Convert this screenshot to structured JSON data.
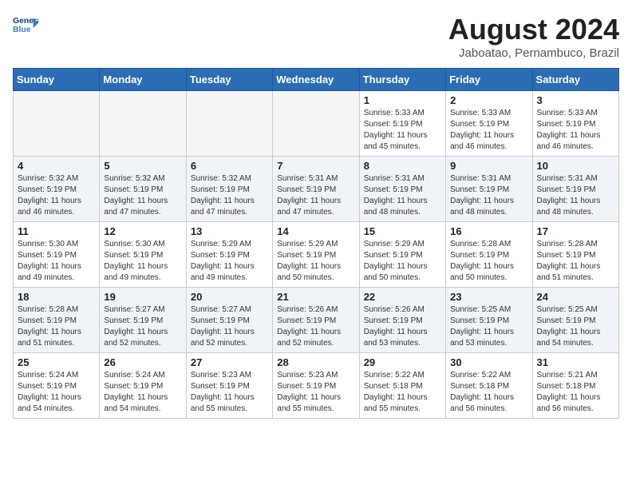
{
  "logo": {
    "line1": "General",
    "line2": "Blue"
  },
  "title": "August 2024",
  "subtitle": "Jaboatao, Pernambuco, Brazil",
  "weekdays": [
    "Sunday",
    "Monday",
    "Tuesday",
    "Wednesday",
    "Thursday",
    "Friday",
    "Saturday"
  ],
  "weeks": [
    [
      {
        "day": "",
        "info": ""
      },
      {
        "day": "",
        "info": ""
      },
      {
        "day": "",
        "info": ""
      },
      {
        "day": "",
        "info": ""
      },
      {
        "day": "1",
        "info": "Sunrise: 5:33 AM\nSunset: 5:19 PM\nDaylight: 11 hours\nand 45 minutes."
      },
      {
        "day": "2",
        "info": "Sunrise: 5:33 AM\nSunset: 5:19 PM\nDaylight: 11 hours\nand 46 minutes."
      },
      {
        "day": "3",
        "info": "Sunrise: 5:33 AM\nSunset: 5:19 PM\nDaylight: 11 hours\nand 46 minutes."
      }
    ],
    [
      {
        "day": "4",
        "info": "Sunrise: 5:32 AM\nSunset: 5:19 PM\nDaylight: 11 hours\nand 46 minutes."
      },
      {
        "day": "5",
        "info": "Sunrise: 5:32 AM\nSunset: 5:19 PM\nDaylight: 11 hours\nand 47 minutes."
      },
      {
        "day": "6",
        "info": "Sunrise: 5:32 AM\nSunset: 5:19 PM\nDaylight: 11 hours\nand 47 minutes."
      },
      {
        "day": "7",
        "info": "Sunrise: 5:31 AM\nSunset: 5:19 PM\nDaylight: 11 hours\nand 47 minutes."
      },
      {
        "day": "8",
        "info": "Sunrise: 5:31 AM\nSunset: 5:19 PM\nDaylight: 11 hours\nand 48 minutes."
      },
      {
        "day": "9",
        "info": "Sunrise: 5:31 AM\nSunset: 5:19 PM\nDaylight: 11 hours\nand 48 minutes."
      },
      {
        "day": "10",
        "info": "Sunrise: 5:31 AM\nSunset: 5:19 PM\nDaylight: 11 hours\nand 48 minutes."
      }
    ],
    [
      {
        "day": "11",
        "info": "Sunrise: 5:30 AM\nSunset: 5:19 PM\nDaylight: 11 hours\nand 49 minutes."
      },
      {
        "day": "12",
        "info": "Sunrise: 5:30 AM\nSunset: 5:19 PM\nDaylight: 11 hours\nand 49 minutes."
      },
      {
        "day": "13",
        "info": "Sunrise: 5:29 AM\nSunset: 5:19 PM\nDaylight: 11 hours\nand 49 minutes."
      },
      {
        "day": "14",
        "info": "Sunrise: 5:29 AM\nSunset: 5:19 PM\nDaylight: 11 hours\nand 50 minutes."
      },
      {
        "day": "15",
        "info": "Sunrise: 5:29 AM\nSunset: 5:19 PM\nDaylight: 11 hours\nand 50 minutes."
      },
      {
        "day": "16",
        "info": "Sunrise: 5:28 AM\nSunset: 5:19 PM\nDaylight: 11 hours\nand 50 minutes."
      },
      {
        "day": "17",
        "info": "Sunrise: 5:28 AM\nSunset: 5:19 PM\nDaylight: 11 hours\nand 51 minutes."
      }
    ],
    [
      {
        "day": "18",
        "info": "Sunrise: 5:28 AM\nSunset: 5:19 PM\nDaylight: 11 hours\nand 51 minutes."
      },
      {
        "day": "19",
        "info": "Sunrise: 5:27 AM\nSunset: 5:19 PM\nDaylight: 11 hours\nand 52 minutes."
      },
      {
        "day": "20",
        "info": "Sunrise: 5:27 AM\nSunset: 5:19 PM\nDaylight: 11 hours\nand 52 minutes."
      },
      {
        "day": "21",
        "info": "Sunrise: 5:26 AM\nSunset: 5:19 PM\nDaylight: 11 hours\nand 52 minutes."
      },
      {
        "day": "22",
        "info": "Sunrise: 5:26 AM\nSunset: 5:19 PM\nDaylight: 11 hours\nand 53 minutes."
      },
      {
        "day": "23",
        "info": "Sunrise: 5:25 AM\nSunset: 5:19 PM\nDaylight: 11 hours\nand 53 minutes."
      },
      {
        "day": "24",
        "info": "Sunrise: 5:25 AM\nSunset: 5:19 PM\nDaylight: 11 hours\nand 54 minutes."
      }
    ],
    [
      {
        "day": "25",
        "info": "Sunrise: 5:24 AM\nSunset: 5:19 PM\nDaylight: 11 hours\nand 54 minutes."
      },
      {
        "day": "26",
        "info": "Sunrise: 5:24 AM\nSunset: 5:19 PM\nDaylight: 11 hours\nand 54 minutes."
      },
      {
        "day": "27",
        "info": "Sunrise: 5:23 AM\nSunset: 5:19 PM\nDaylight: 11 hours\nand 55 minutes."
      },
      {
        "day": "28",
        "info": "Sunrise: 5:23 AM\nSunset: 5:19 PM\nDaylight: 11 hours\nand 55 minutes."
      },
      {
        "day": "29",
        "info": "Sunrise: 5:22 AM\nSunset: 5:18 PM\nDaylight: 11 hours\nand 55 minutes."
      },
      {
        "day": "30",
        "info": "Sunrise: 5:22 AM\nSunset: 5:18 PM\nDaylight: 11 hours\nand 56 minutes."
      },
      {
        "day": "31",
        "info": "Sunrise: 5:21 AM\nSunset: 5:18 PM\nDaylight: 11 hours\nand 56 minutes."
      }
    ]
  ]
}
